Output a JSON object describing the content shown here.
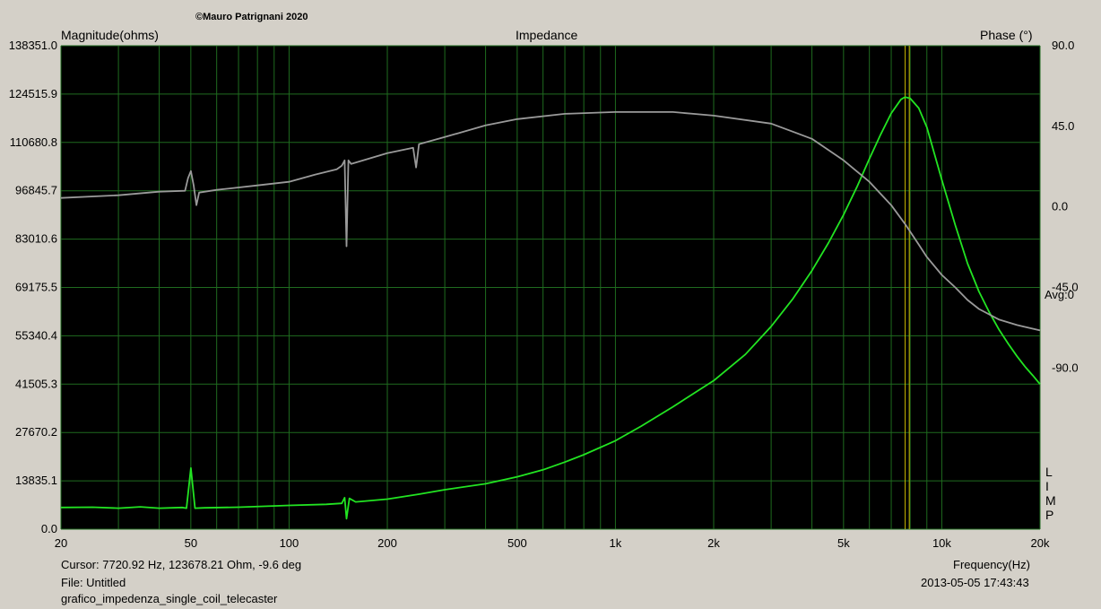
{
  "header": {
    "copyright": "©Mauro Patrignani 2020",
    "left_axis_title": "Magnitude(ohms)",
    "title": "Impedance",
    "right_axis_title": "Phase (°)"
  },
  "footer": {
    "cursor": "Cursor: 7720.92 Hz, 123678.21 Ohm, -9.6 deg",
    "file": "File: Untitled",
    "filename": "grafico_impedenza_single_coil_telecaster",
    "x_axis_title": "Frequency(Hz)",
    "timestamp": "2013-05-05 17:43:43"
  },
  "side_labels": {
    "avg": "Avg:0",
    "limp": [
      "L",
      "I",
      "M",
      "P"
    ]
  },
  "colors": {
    "background": "#000000",
    "grid": "#1f6b1f",
    "magnitude": "#22e422",
    "phase": "#9a9a9a",
    "cursor": "#c8b400",
    "panel": "#d4d0c8"
  },
  "chart_data": {
    "type": "line",
    "title": "Impedance",
    "xlabel": "Frequency(Hz)",
    "ylabel": "Magnitude(ohms)",
    "y2label": "Phase (°)",
    "xscale": "log",
    "xlim": [
      20,
      20000
    ],
    "ylim": [
      0,
      138351
    ],
    "y2lim": [
      -180,
      90
    ],
    "x_ticks": [
      {
        "value": 20,
        "label": "20"
      },
      {
        "value": 50,
        "label": "50"
      },
      {
        "value": 100,
        "label": "100"
      },
      {
        "value": 200,
        "label": "200"
      },
      {
        "value": 500,
        "label": "500"
      },
      {
        "value": 1000,
        "label": "1k"
      },
      {
        "value": 2000,
        "label": "2k"
      },
      {
        "value": 5000,
        "label": "5k"
      },
      {
        "value": 10000,
        "label": "10k"
      },
      {
        "value": 20000,
        "label": "20k"
      }
    ],
    "y_ticks": [
      {
        "value": 0,
        "label": "0.0"
      },
      {
        "value": 13835.1,
        "label": "13835.1"
      },
      {
        "value": 27670.2,
        "label": "27670.2"
      },
      {
        "value": 41505.3,
        "label": "41505.3"
      },
      {
        "value": 55340.4,
        "label": "55340.4"
      },
      {
        "value": 69175.5,
        "label": "69175.5"
      },
      {
        "value": 83010.6,
        "label": "83010.6"
      },
      {
        "value": 96845.7,
        "label": "96845.7"
      },
      {
        "value": 110680.8,
        "label": "110680.8"
      },
      {
        "value": 124515.9,
        "label": "124515.9"
      },
      {
        "value": 138351.0,
        "label": "138351.0"
      }
    ],
    "y2_ticks": [
      {
        "value": 90,
        "label": "90.0"
      },
      {
        "value": 45,
        "label": "45.0"
      },
      {
        "value": 0,
        "label": "0.0"
      },
      {
        "value": -45,
        "label": "-45.0"
      },
      {
        "value": -90,
        "label": "-90.0"
      }
    ],
    "cursor_frequency": 7720.92,
    "cursor_frequency_secondary": 7950,
    "series": [
      {
        "id": "magnitude",
        "axis": "left",
        "color": "#22e422",
        "points": [
          [
            20,
            6200
          ],
          [
            25,
            6300
          ],
          [
            30,
            6000
          ],
          [
            35,
            6400
          ],
          [
            40,
            6000
          ],
          [
            47,
            6200
          ],
          [
            48.5,
            6000
          ],
          [
            50,
            17500
          ],
          [
            51.5,
            6000
          ],
          [
            55,
            6100
          ],
          [
            70,
            6300
          ],
          [
            100,
            6800
          ],
          [
            130,
            7100
          ],
          [
            145,
            7400
          ],
          [
            148,
            9000
          ],
          [
            150,
            3000
          ],
          [
            153,
            8800
          ],
          [
            160,
            7800
          ],
          [
            200,
            8600
          ],
          [
            250,
            10000
          ],
          [
            300,
            11300
          ],
          [
            400,
            13000
          ],
          [
            500,
            15000
          ],
          [
            600,
            17000
          ],
          [
            700,
            19200
          ],
          [
            800,
            21300
          ],
          [
            1000,
            25300
          ],
          [
            1200,
            29500
          ],
          [
            1500,
            35000
          ],
          [
            2000,
            42500
          ],
          [
            2500,
            50000
          ],
          [
            3000,
            58000
          ],
          [
            3500,
            66000
          ],
          [
            4000,
            74000
          ],
          [
            4500,
            82000
          ],
          [
            5000,
            90000
          ],
          [
            5500,
            98000
          ],
          [
            6000,
            106000
          ],
          [
            6500,
            113000
          ],
          [
            7000,
            119000
          ],
          [
            7500,
            123000
          ],
          [
            7720.92,
            123678
          ],
          [
            8000,
            123300
          ],
          [
            8500,
            120500
          ],
          [
            9000,
            115000
          ],
          [
            10000,
            100000
          ],
          [
            11000,
            87000
          ],
          [
            12000,
            76000
          ],
          [
            13000,
            68000
          ],
          [
            14000,
            62000
          ],
          [
            15000,
            57000
          ],
          [
            16000,
            53000
          ],
          [
            17000,
            49500
          ],
          [
            18000,
            46500
          ],
          [
            19000,
            44000
          ],
          [
            20000,
            41500
          ]
        ]
      },
      {
        "id": "phase",
        "axis": "right",
        "color": "#9a9a9a",
        "points": [
          [
            20,
            5
          ],
          [
            30,
            6.5
          ],
          [
            40,
            8.5
          ],
          [
            48,
            9
          ],
          [
            49,
            16
          ],
          [
            50,
            20
          ],
          [
            51,
            12
          ],
          [
            52,
            1
          ],
          [
            53,
            8
          ],
          [
            60,
            9.5
          ],
          [
            80,
            12
          ],
          [
            100,
            14
          ],
          [
            120,
            18
          ],
          [
            140,
            21
          ],
          [
            145,
            23
          ],
          [
            148,
            26
          ],
          [
            150,
            -22
          ],
          [
            152,
            26
          ],
          [
            155,
            24
          ],
          [
            200,
            30
          ],
          [
            240,
            33
          ],
          [
            245,
            22
          ],
          [
            250,
            35
          ],
          [
            300,
            39
          ],
          [
            400,
            45.5
          ],
          [
            500,
            49
          ],
          [
            700,
            52
          ],
          [
            1000,
            53
          ],
          [
            1500,
            53
          ],
          [
            2000,
            51
          ],
          [
            3000,
            46.5
          ],
          [
            4000,
            38
          ],
          [
            5000,
            26
          ],
          [
            6000,
            14
          ],
          [
            7000,
            1
          ],
          [
            7720.92,
            -9.6
          ],
          [
            8500,
            -21
          ],
          [
            9000,
            -28
          ],
          [
            10000,
            -38
          ],
          [
            11000,
            -45
          ],
          [
            12000,
            -52
          ],
          [
            13000,
            -57
          ],
          [
            15000,
            -63
          ],
          [
            17000,
            -66
          ],
          [
            20000,
            -69
          ]
        ]
      }
    ]
  }
}
